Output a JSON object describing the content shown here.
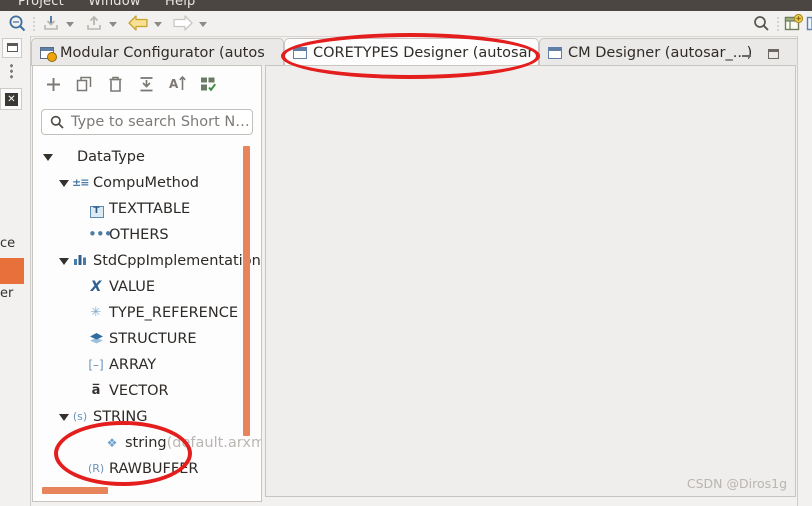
{
  "menubar": {
    "items": [
      "Project",
      "Window",
      "Help"
    ]
  },
  "toolbar": {
    "search_icon": "search-icon",
    "buttons": [
      {
        "name": "import-button",
        "glyph": "⬇",
        "has_caret": true
      },
      {
        "name": "export-button",
        "glyph": "⬆",
        "has_caret": true
      },
      {
        "name": "back-button",
        "glyph": "←",
        "has_caret": true
      },
      {
        "name": "forward-button",
        "glyph": "→",
        "has_caret": true
      }
    ],
    "right_icons": [
      "search-icon",
      "new-perspective-icon",
      "perspective-icon"
    ]
  },
  "leftrail": {
    "restore_icon": "restore-view-icon",
    "handle_icon": "drag-handle-icon",
    "close_icon": "close-view-icon",
    "fragment_top": "ce",
    "fragment_bottom": "er"
  },
  "tabs": [
    {
      "name": "tab-modular-configurator",
      "label": "Modular Configurator (autos",
      "icon": "configurator-icon",
      "active": false,
      "closable": false
    },
    {
      "name": "tab-coretypes-designer",
      "label": "CORETYPES Designer (autosar",
      "icon": "designer-icon",
      "active": true,
      "closable": true,
      "close_glyph": "⌧"
    },
    {
      "name": "tab-cm-designer",
      "label": "CM Designer (autosar_...)",
      "icon": "designer-icon",
      "active": false,
      "closable": false
    }
  ],
  "panel": {
    "toolbar_buttons": [
      {
        "name": "add-button",
        "glyph": "+"
      },
      {
        "name": "duplicate-button",
        "glyph": "⧉"
      },
      {
        "name": "delete-button",
        "glyph": "🗑"
      },
      {
        "name": "collapse-all-button",
        "glyph": "⤓"
      },
      {
        "name": "sort-button",
        "glyph": "A↓"
      },
      {
        "name": "filter-button",
        "glyph": "⊞"
      }
    ],
    "search": {
      "icon": "search-icon",
      "placeholder": "Type to search Short N…",
      "value": ""
    },
    "tree": [
      {
        "name": "tree-item-datatype",
        "label": "DataType",
        "indent": 0,
        "expanded": true,
        "icon": "pie-icon",
        "icon_kind": "pie"
      },
      {
        "name": "tree-item-compumethod",
        "label": "CompuMethod",
        "indent": 1,
        "expanded": true,
        "icon": "compumethod-icon",
        "icon_kind": "compu",
        "glyph": "±≡"
      },
      {
        "name": "tree-item-texttable",
        "label": "TEXTTABLE",
        "indent": 2,
        "expanded": null,
        "icon": "texttable-icon",
        "icon_kind": "tt",
        "glyph": "T"
      },
      {
        "name": "tree-item-others",
        "label": "OTHERS",
        "indent": 2,
        "expanded": null,
        "icon": "others-icon",
        "icon_kind": "dots",
        "glyph": "•••"
      },
      {
        "name": "tree-item-stdcppimplementation",
        "label": "StdCppImplementation",
        "indent": 1,
        "expanded": true,
        "icon": "bars-icon",
        "icon_kind": "bars",
        "glyph": "▐█▐"
      },
      {
        "name": "tree-item-value",
        "label": "VALUE",
        "indent": 2,
        "expanded": null,
        "icon": "value-icon",
        "icon_kind": "x",
        "glyph": "X"
      },
      {
        "name": "tree-item-type-reference",
        "label": "TYPE_REFERENCE",
        "indent": 2,
        "expanded": null,
        "icon": "type-reference-icon",
        "icon_kind": "star",
        "glyph": "✳"
      },
      {
        "name": "tree-item-structure",
        "label": "STRUCTURE",
        "indent": 2,
        "expanded": null,
        "icon": "structure-icon",
        "icon_kind": "struct",
        "glyph": "◆"
      },
      {
        "name": "tree-item-array",
        "label": "ARRAY",
        "indent": 2,
        "expanded": null,
        "icon": "array-icon",
        "icon_kind": "arr",
        "glyph": "[–]"
      },
      {
        "name": "tree-item-vector",
        "label": "VECTOR",
        "indent": 2,
        "expanded": null,
        "icon": "vector-icon",
        "icon_kind": "vec",
        "glyph": "a̅"
      },
      {
        "name": "tree-item-string",
        "label": "STRING",
        "indent": 2,
        "expanded": true,
        "icon": "string-icon",
        "icon_kind": "paren",
        "glyph": "(s)"
      },
      {
        "name": "tree-item-string-default",
        "label": "string",
        "label_dim": "(default.arxm",
        "indent": 3,
        "expanded": null,
        "icon": "instance-icon",
        "icon_kind": "dia",
        "glyph": "❖"
      },
      {
        "name": "tree-item-rawbuffer",
        "label": "RAWBUFFER",
        "indent": 2,
        "expanded": null,
        "icon": "rawbuffer-icon",
        "icon_kind": "paren",
        "glyph": "(R)"
      }
    ],
    "scrollbar_color": "#e8845c"
  },
  "editor": {
    "name": "coretypes-designer-canvas",
    "content": "",
    "watermark": "CSDN @Diros1g",
    "background": "#efeeed"
  },
  "annotations": {
    "color": "#e41d1d",
    "ellipses": [
      {
        "name": "annotation-ellipse-tab",
        "target": "tab-coretypes-designer"
      },
      {
        "name": "annotation-ellipse-string",
        "target": "tree-item-string"
      }
    ]
  }
}
